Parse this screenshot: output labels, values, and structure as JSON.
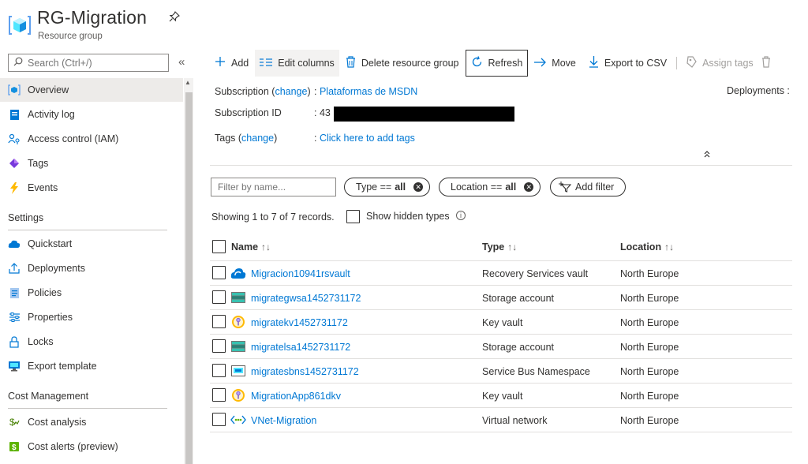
{
  "header": {
    "title": "RG-Migration",
    "subtitle": "Resource group"
  },
  "sidebar": {
    "search_placeholder": "Search (Ctrl+/)",
    "items": [
      {
        "label": "Overview",
        "icon": "resource-group-icon"
      },
      {
        "label": "Activity log",
        "icon": "activity-log-icon"
      },
      {
        "label": "Access control (IAM)",
        "icon": "iam-icon"
      },
      {
        "label": "Tags",
        "icon": "tag-icon"
      },
      {
        "label": "Events",
        "icon": "lightning-icon"
      }
    ],
    "settings_header": "Settings",
    "settings_items": [
      {
        "label": "Quickstart",
        "icon": "quickstart-icon"
      },
      {
        "label": "Deployments",
        "icon": "deployments-icon"
      },
      {
        "label": "Policies",
        "icon": "policies-icon"
      },
      {
        "label": "Properties",
        "icon": "properties-icon"
      },
      {
        "label": "Locks",
        "icon": "lock-icon"
      },
      {
        "label": "Export template",
        "icon": "export-template-icon"
      }
    ],
    "cost_header": "Cost Management",
    "cost_items": [
      {
        "label": "Cost analysis",
        "icon": "cost-analysis-icon"
      },
      {
        "label": "Cost alerts (preview)",
        "icon": "cost-alerts-icon"
      }
    ]
  },
  "toolbar": {
    "add": "Add",
    "edit_columns": "Edit columns",
    "delete": "Delete resource group",
    "refresh": "Refresh",
    "move": "Move",
    "export_csv": "Export to CSV",
    "assign_tags": "Assign tags"
  },
  "essentials": {
    "subscription_label": "Subscription",
    "change": "change",
    "subscription_value": "Plataformas de MSDN",
    "subscription_id_label": "Subscription ID",
    "subscription_id_value": "43",
    "tags_label": "Tags",
    "tags_value": "Click here to add tags",
    "deployments_label": "Deployments :"
  },
  "filters": {
    "name_placeholder": "Filter by name...",
    "type_label": "Type ==",
    "type_value": "all",
    "location_label": "Location ==",
    "location_value": "all",
    "add_filter": "Add filter"
  },
  "records_text": "Showing 1 to 7 of 7 records.",
  "show_hidden": "Show hidden types",
  "table": {
    "columns": [
      "Name",
      "Type",
      "Location"
    ],
    "rows": [
      {
        "name": "Migracion10941rsvault",
        "type": "Recovery Services vault",
        "location": "North Europe",
        "icon": "recovery-vault-icon"
      },
      {
        "name": "migrategwsa1452731172",
        "type": "Storage account",
        "location": "North Europe",
        "icon": "storage-account-icon"
      },
      {
        "name": "migratekv1452731172",
        "type": "Key vault",
        "location": "North Europe",
        "icon": "key-vault-icon"
      },
      {
        "name": "migratelsa1452731172",
        "type": "Storage account",
        "location": "North Europe",
        "icon": "storage-account-icon"
      },
      {
        "name": "migratesbns1452731172",
        "type": "Service Bus Namespace",
        "location": "North Europe",
        "icon": "service-bus-icon"
      },
      {
        "name": "MigrationApp861dkv",
        "type": "Key vault",
        "location": "North Europe",
        "icon": "key-vault-icon"
      },
      {
        "name": "VNet-Migration",
        "type": "Virtual network",
        "location": "North Europe",
        "icon": "virtual-network-icon"
      }
    ]
  },
  "colors": {
    "accent": "#0078d4",
    "text": "#323130",
    "selected_bg": "#edebe9"
  }
}
